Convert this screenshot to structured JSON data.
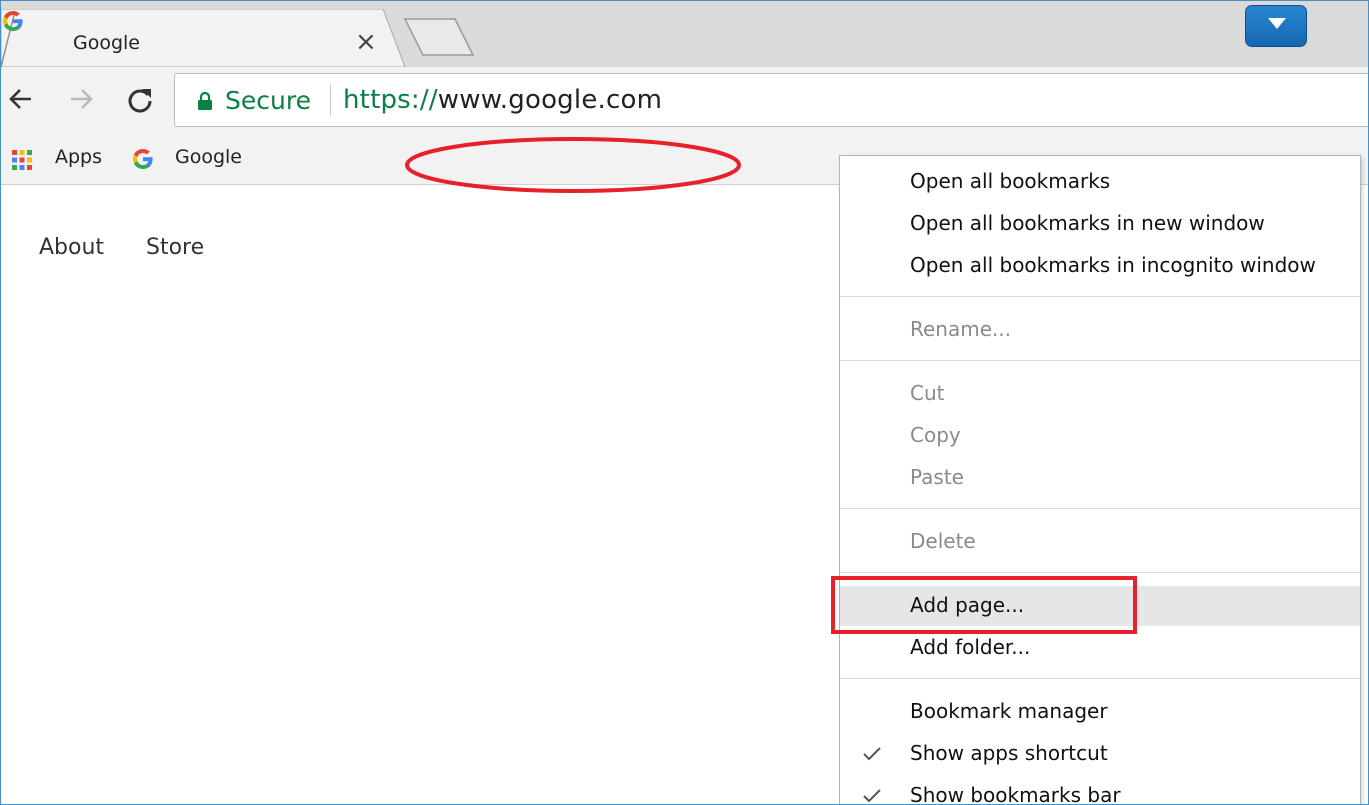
{
  "tab": {
    "title": "Google",
    "close_glyph": "×"
  },
  "toolbar": {
    "secure_label": "Secure",
    "url_scheme": "https://",
    "url_rest": "www.google.com"
  },
  "bookmarks": {
    "apps_label": "Apps",
    "google_label": "Google"
  },
  "page": {
    "about": "About",
    "store": "Store"
  },
  "menu": {
    "open_all": "Open all bookmarks",
    "open_all_new_window": "Open all bookmarks in new window",
    "open_all_incognito": "Open all bookmarks in incognito window",
    "rename": "Rename...",
    "cut": "Cut",
    "copy": "Copy",
    "paste": "Paste",
    "delete": "Delete",
    "add_page": "Add page...",
    "add_folder": "Add folder...",
    "bookmark_manager": "Bookmark manager",
    "show_apps_shortcut": "Show apps shortcut",
    "show_bookmarks_bar": "Show bookmarks bar"
  },
  "colors": {
    "secure_green": "#0b8043",
    "annotation_red": "#e8202a",
    "profile_blue": "#1f7ac6"
  },
  "icons": [
    "google-g-icon",
    "close-icon",
    "new-tab-icon",
    "profile-menu-icon",
    "back-arrow-icon",
    "forward-arrow-icon",
    "reload-icon",
    "lock-icon",
    "apps-grid-icon",
    "check-icon"
  ]
}
